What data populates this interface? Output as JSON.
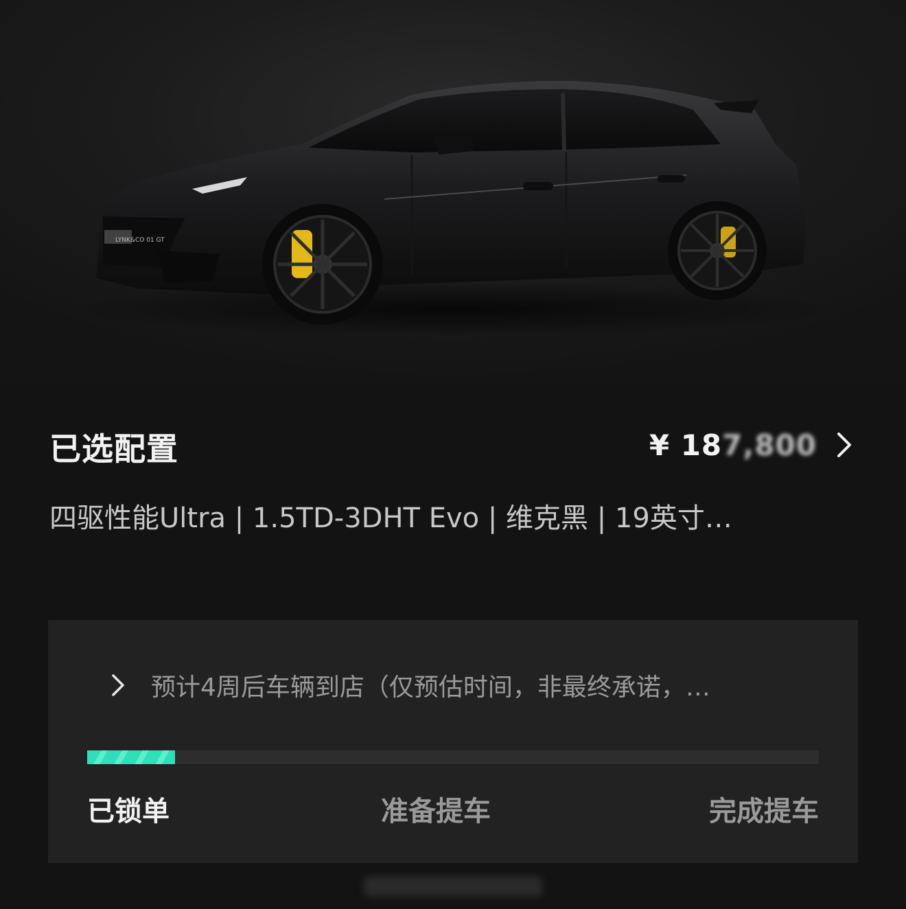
{
  "hero": {
    "image": "car-side-profile",
    "badge": "LYNK&CO 01 GT"
  },
  "config": {
    "title": "已选配置",
    "price_prefix": "¥ 18",
    "price_rest": "7,800",
    "description": "四驱性能Ultra | 1.5TD-3DHT Evo | 维克黑 | 19英寸…"
  },
  "delivery": {
    "estimate_text": "预计4周后车辆到店（仅预估时间，非最终承诺，…",
    "progress": 0.12,
    "steps": [
      "已锁单",
      "准备提车",
      "完成提车"
    ],
    "accent_color": "#2ee0b7"
  }
}
